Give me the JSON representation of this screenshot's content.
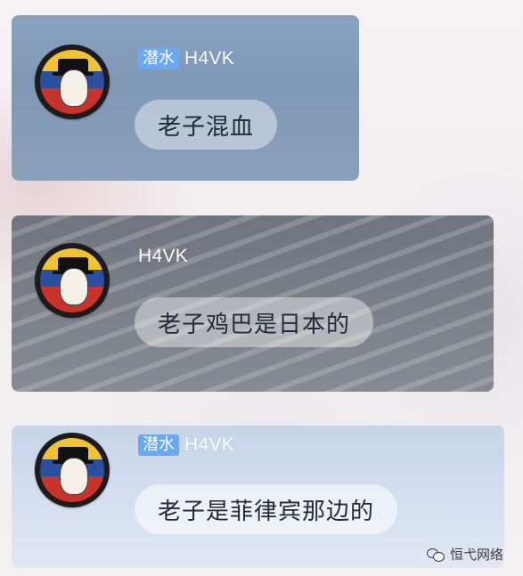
{
  "messages": [
    {
      "badge": "潜水",
      "username": "H4VK",
      "text": "老子混血"
    },
    {
      "badge": "",
      "username": "H4VK",
      "text": "老子鸡巴是日本的"
    },
    {
      "badge": "潜水",
      "username": "H4VK",
      "text": "老子是菲律宾那边的"
    }
  ],
  "watermark": {
    "icon": "wechat-icon",
    "text": "恒弋网络"
  },
  "colors": {
    "badge": "#6aa9ee",
    "username": "#ffffff",
    "bubble_text": "#222a36"
  }
}
